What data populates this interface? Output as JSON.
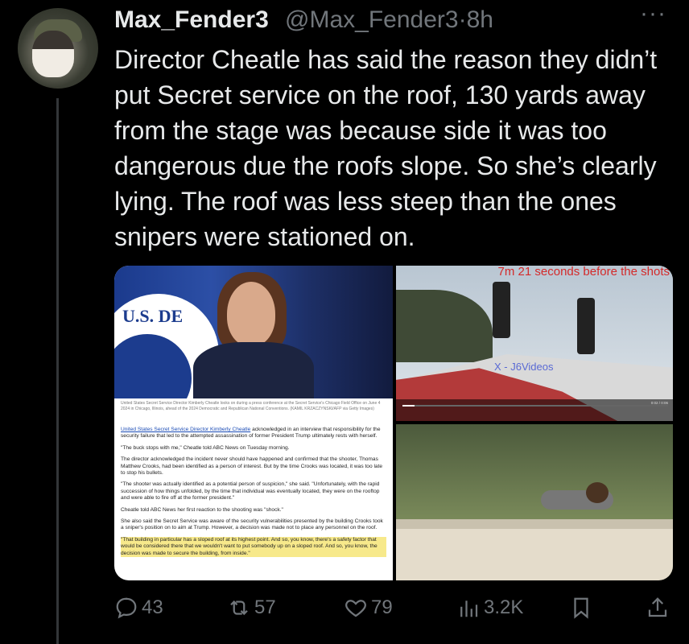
{
  "tweet": {
    "display_name": "Max_Fender3",
    "handle": "@Max_Fender3",
    "separator": "·",
    "time": "8h",
    "more": "···",
    "text": "Director Cheatle has said the reason they didn’t put Secret service on the roof, 130 yards away from the stage was because side it was too dangerous due the roofs slope.  So she’s clearly lying.  The roof was less steep than the ones snipers were stationed on."
  },
  "media": {
    "seal_text": "U.S.    DE",
    "caption": "United States Secret Service Director Kimberly Cheatle looks on during a press conference at the Secret Service's Chicago Field Office on June 4 2024 in Chicago, Illinois, ahead of the 2024 Democratic and Republican National Conventions. (KAMIL KRZACZYNSKI/AFP via Getty Images)",
    "article": {
      "p1_link": "United States Secret Service Director Kimberly Cheatle",
      "p1_rest": " acknowledged in an interview that responsibility for the security failure that led to the attempted assassination of former President Trump ultimately rests with herself.",
      "p2": "\"The buck stops with me,\" Cheatle told ABC News on Tuesday morning.",
      "p3": "The director acknowledged the incident never should have happened and confirmed that the shooter, Thomas Matthew Crooks, had been identified as a person of interest. But by the time Crooks was located, it was too late to stop his bullets.",
      "p4": "\"The shooter was actually identified as a potential person of suspicion,\" she said. \"Unfortunately, with the rapid succession of how things unfolded, by the time that individual was eventually located, they were on the rooftop and were able to fire off at the former president.\"",
      "p5": "Cheatle told ABC News her first reaction to the shooting was \"shock.\"",
      "p6": "She also said the Secret Service was aware of the security vulnerabilities presented by the building Crooks took a sniper's position on to aim at Trump. However, a decision was made not to place any personnel on the roof.",
      "p7": "\"That building in particular has a sloped roof at its highest point. And so, you know, there's a safety factor that would be considered there that we wouldn't want to put somebody up on a sloped roof. And so, you know, the decision was made to secure the building, from inside.\""
    },
    "video_label": "7m 21 seconds before the shots",
    "watermark": "X - J6Videos",
    "video_time": "0:02 / 0:06"
  },
  "actions": {
    "replies": "43",
    "reposts": "57",
    "likes": "79",
    "views": "3.2K"
  },
  "colors": {
    "background": "#000000",
    "text": "#e7e9ea",
    "muted": "#71767b"
  }
}
